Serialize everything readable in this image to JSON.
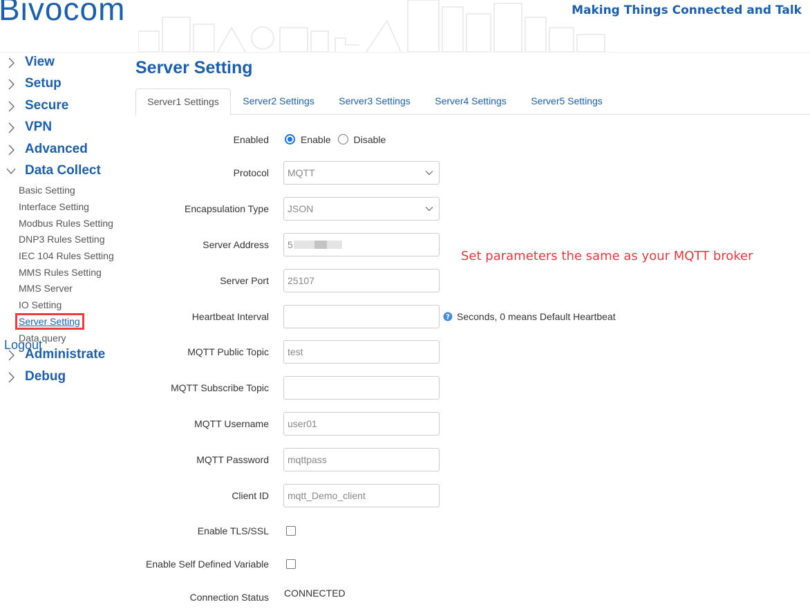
{
  "header": {
    "logo": "Bivocom",
    "tagline": "Making Things Connected and Talk"
  },
  "sidebar": {
    "top_items": [
      {
        "label": "View"
      },
      {
        "label": "Setup"
      },
      {
        "label": "Secure"
      },
      {
        "label": "VPN"
      },
      {
        "label": "Advanced"
      },
      {
        "label": "Data Collect"
      }
    ],
    "sub_items": [
      {
        "label": "Basic Setting"
      },
      {
        "label": "Interface Setting"
      },
      {
        "label": "Modbus Rules Setting"
      },
      {
        "label": "DNP3 Rules Setting"
      },
      {
        "label": "IEC 104 Rules Setting"
      },
      {
        "label": "MMS Rules Setting"
      },
      {
        "label": "MMS Server"
      },
      {
        "label": "IO Setting"
      },
      {
        "label": "Server Setting"
      },
      {
        "label": "Data query"
      }
    ],
    "bottom_items": [
      {
        "label": "Administrate"
      },
      {
        "label": "Debug"
      }
    ],
    "logout": "Logout"
  },
  "main": {
    "title": "Server Setting",
    "tabs": [
      {
        "label": "Server1 Settings"
      },
      {
        "label": "Server2 Settings"
      },
      {
        "label": "Server3 Settings"
      },
      {
        "label": "Server4 Settings"
      },
      {
        "label": "Server5 Settings"
      }
    ],
    "form": {
      "enabled": {
        "label": "Enabled",
        "enable": "Enable",
        "disable": "Disable"
      },
      "protocol": {
        "label": "Protocol",
        "value": "MQTT"
      },
      "encapsulation": {
        "label": "Encapsulation Type",
        "value": "JSON"
      },
      "server_address": {
        "label": "Server Address",
        "value": "5"
      },
      "server_port": {
        "label": "Server Port",
        "value": "25107"
      },
      "heartbeat": {
        "label": "Heartbeat Interval",
        "value": "",
        "help": "Seconds, 0 means Default Heartbeat"
      },
      "public_topic": {
        "label": "MQTT Public Topic",
        "value": "test"
      },
      "subscribe_topic": {
        "label": "MQTT Subscribe Topic",
        "value": ""
      },
      "username": {
        "label": "MQTT Username",
        "value": "user01"
      },
      "password": {
        "label": "MQTT Password",
        "value": "mqttpass"
      },
      "client_id": {
        "label": "Client ID",
        "value": "mqtt_Demo_client"
      },
      "tls": {
        "label": "Enable TLS/SSL"
      },
      "self_defined": {
        "label": "Enable Self Defined Variable"
      },
      "status": {
        "label": "Connection Status",
        "value": "CONNECTED"
      }
    },
    "annotation": "Set parameters the same as your MQTT broker"
  },
  "colors": {
    "brand": "#1d5fa8",
    "annotation": "#e0393e",
    "highlight_box": "#e83e3e"
  }
}
